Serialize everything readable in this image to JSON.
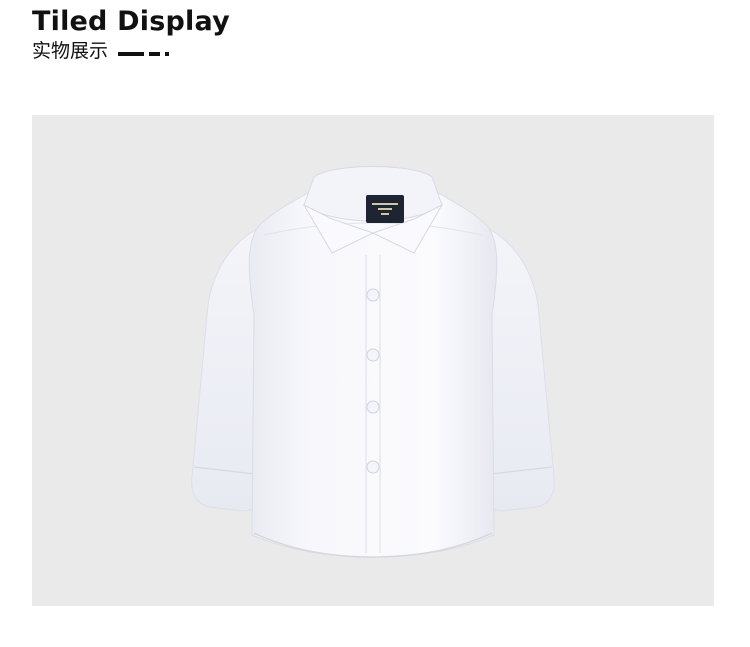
{
  "header": {
    "title": "Tiled Display",
    "subtitle": "实物展示"
  },
  "product_image": {
    "subject": "shirt-illustration",
    "colors": {
      "backdrop": "#eaeaea",
      "shirt": "#f7f7fb",
      "label": "#1f2433"
    }
  }
}
